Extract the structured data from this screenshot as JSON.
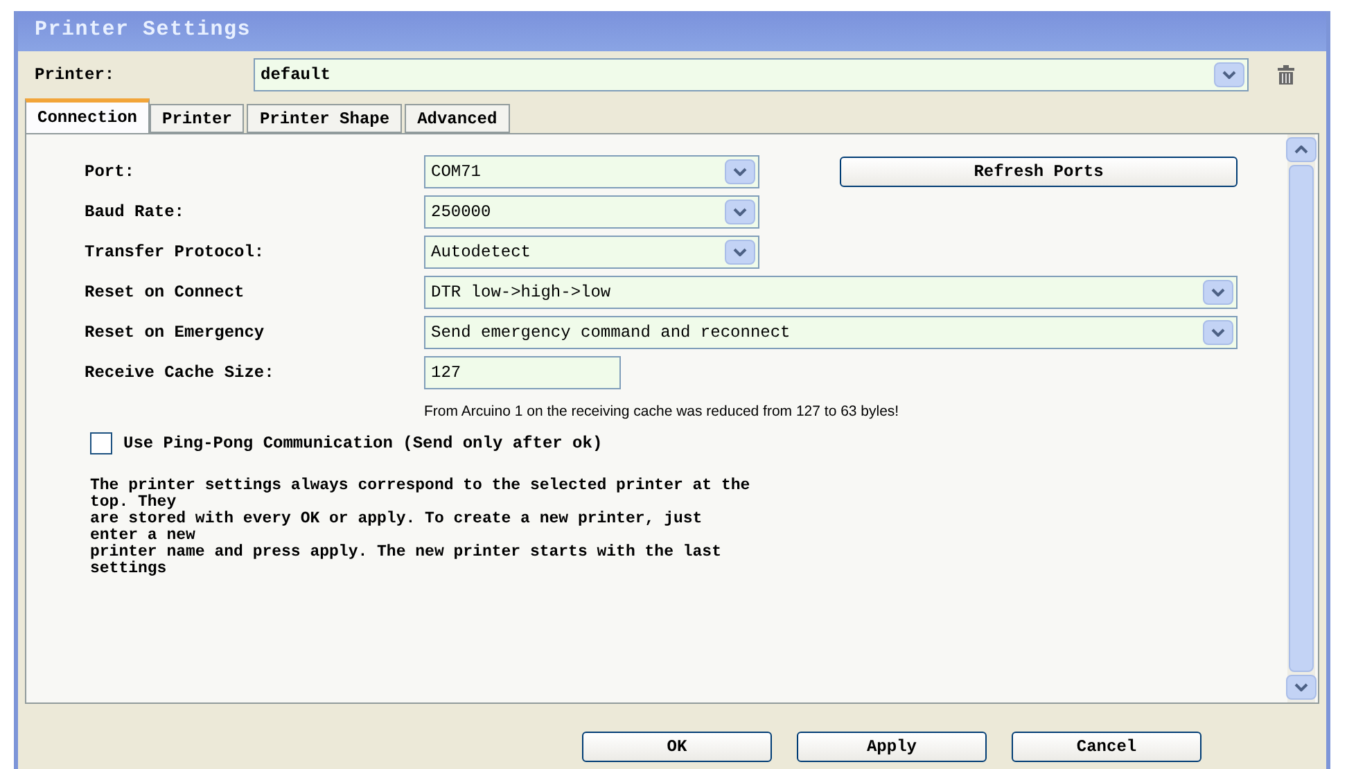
{
  "window": {
    "title": "Printer Settings"
  },
  "printer": {
    "label": "Printer:",
    "value": "default"
  },
  "tabs": [
    {
      "label": "Connection",
      "selected": true
    },
    {
      "label": "Printer",
      "selected": false
    },
    {
      "label": "Printer Shape",
      "selected": false
    },
    {
      "label": "Advanced",
      "selected": false
    }
  ],
  "fields": [
    {
      "kind": "combo",
      "label": "Port:",
      "value": "COM71",
      "wide": false
    },
    {
      "kind": "combo",
      "label": "Baud Rate:",
      "value": "250000",
      "wide": false
    },
    {
      "kind": "combo",
      "label": "Transfer Protocol:",
      "value": "Autodetect",
      "wide": false
    },
    {
      "kind": "combo",
      "label": "Reset on Connect",
      "value": "DTR low->high->low",
      "wide": true
    },
    {
      "kind": "combo",
      "label": "Reset on Emergency",
      "value": "Send emergency command and reconnect",
      "wide": true
    },
    {
      "kind": "text",
      "label": "Receive Cache Size:",
      "value": "127",
      "wide": false
    }
  ],
  "refresh_button": "Refresh Ports",
  "cache_note": "From Arcuino 1 on the receiving cache was reduced from 127 to 63 byles!",
  "ping_pong": {
    "label": "Use Ping-Pong Communication (Send only after ok)",
    "checked": false
  },
  "help_lines": [
    "The printer settings always correspond to the selected printer at the",
    "top. They",
    "are stored with every OK or apply. To create a new printer, just",
    "enter a new",
    "printer name and press apply. The new printer starts with the last",
    "settings"
  ],
  "buttons": [
    "OK",
    "Apply",
    "Cancel"
  ]
}
